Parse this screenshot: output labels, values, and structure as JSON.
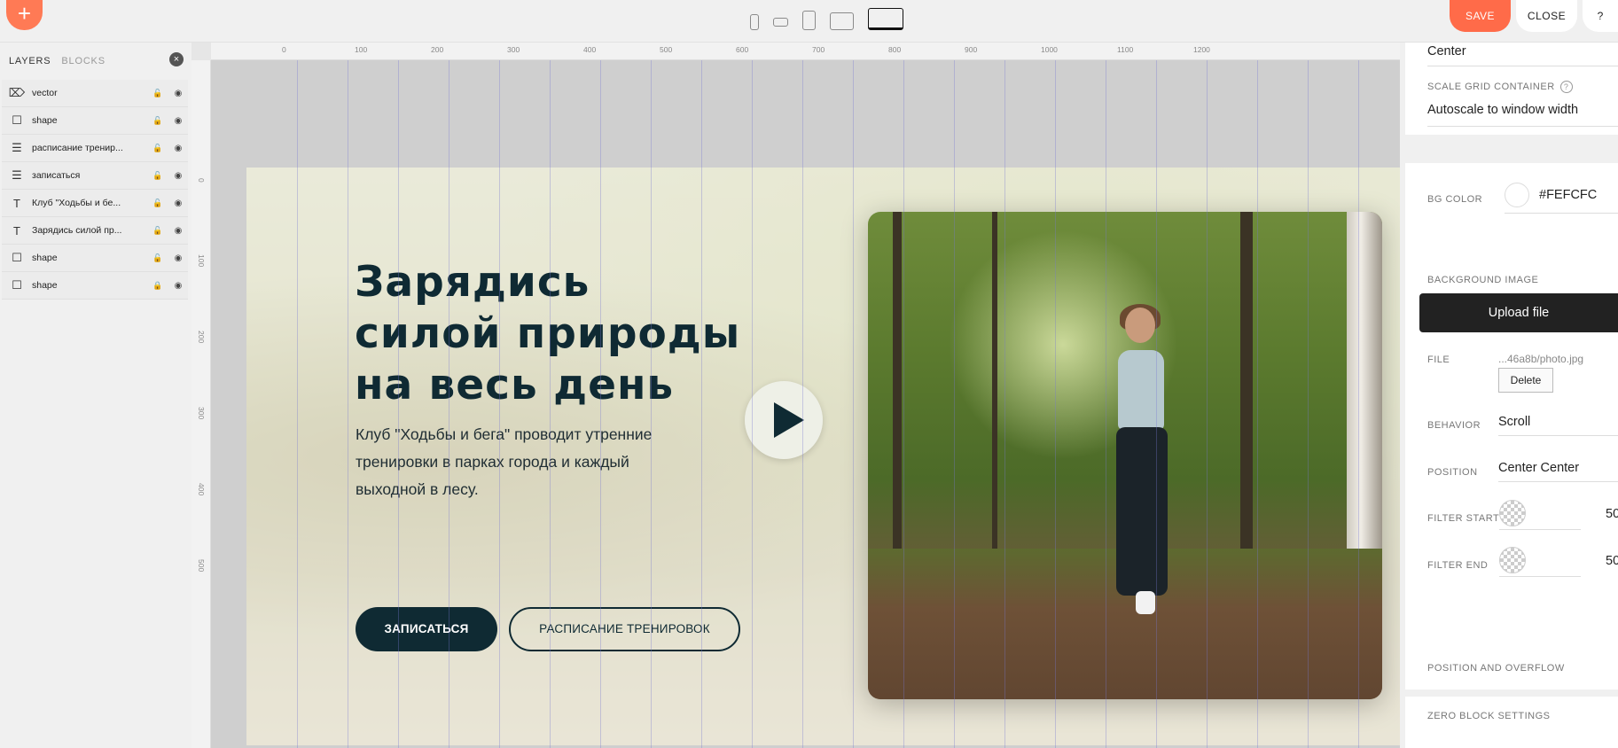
{
  "toolbar": {
    "add_label": "+",
    "save_label": "SAVE",
    "close_label": "CLOSE",
    "help_label": "?",
    "devices": [
      "mobile-portrait",
      "mobile-landscape",
      "tablet-portrait",
      "tablet-landscape",
      "desktop"
    ],
    "active_device": "desktop"
  },
  "layers_panel": {
    "tabs": [
      "LAYERS",
      "BLOCKS"
    ],
    "active_tab": "LAYERS",
    "close_label": "×",
    "items": [
      {
        "icon": "vector-icon",
        "label": "vector",
        "lock": "open"
      },
      {
        "icon": "shape-icon",
        "label": "shape",
        "lock": "open"
      },
      {
        "icon": "button-icon",
        "label": "расписание тренир...",
        "lock": "open"
      },
      {
        "icon": "button-icon",
        "label": "записаться",
        "lock": "open"
      },
      {
        "icon": "text-icon",
        "label": "Клуб \"Ходьбы и бе...",
        "lock": "open"
      },
      {
        "icon": "text-icon",
        "label": "Зарядись силой пр...",
        "lock": "open"
      },
      {
        "icon": "shape-icon",
        "label": "shape",
        "lock": "open"
      },
      {
        "icon": "shape-icon",
        "label": "shape",
        "lock": "closed"
      }
    ]
  },
  "ruler": {
    "top": [
      "0",
      "100",
      "200",
      "300",
      "400",
      "500",
      "600",
      "700",
      "800",
      "900",
      "1000",
      "1100",
      "1200"
    ],
    "left": [
      "0",
      "100",
      "200",
      "300",
      "400",
      "500"
    ]
  },
  "artboard": {
    "headline_lines": [
      "Зарядись",
      "силой природы",
      "на весь день"
    ],
    "description": "Клуб \"Ходьбы и бега\" проводит утренние тренировки в парках города и каждый выходной в лесу.",
    "primary_button": "ЗАПИСАТЬСЯ",
    "secondary_button": "РАСПИСАНИЕ ТРЕНИРОВОК",
    "text_color": "#0f2a33"
  },
  "settings": {
    "alignment_value": "Center",
    "scale_grid_label": "SCALE GRID CONTAINER",
    "scale_grid_value": "Autoscale to window width",
    "bg_color_label": "BG COLOR",
    "bg_color_value": "#FEFCFC",
    "bg_image_label": "BACKGROUND IMAGE",
    "upload_label": "Upload file",
    "file_label": "FILE",
    "file_value": "...46a8b/photo.jpg",
    "delete_label": "Delete",
    "behavior_label": "BEHAVIOR",
    "behavior_value": "Scroll",
    "position_label": "POSITION",
    "position_value": "Center Center",
    "filter_start_label": "FILTER START",
    "filter_start_value": "50",
    "filter_end_label": "FILTER END",
    "filter_end_value": "50",
    "position_overflow_label": "POSITION AND OVERFLOW",
    "zero_block_label": "ZERO BLOCK SETTINGS"
  }
}
